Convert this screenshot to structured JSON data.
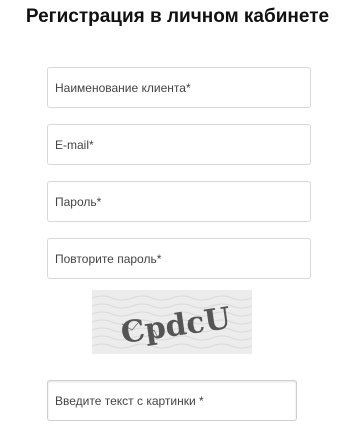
{
  "title": "Регистрация в личном кабинете",
  "fields": {
    "client_name": {
      "placeholder": "Наименование клиента*",
      "value": ""
    },
    "email": {
      "placeholder": "E-mail*",
      "value": ""
    },
    "password": {
      "placeholder": "Пароль*",
      "value": ""
    },
    "password_repeat": {
      "placeholder": "Повторите пароль*",
      "value": ""
    },
    "captcha_text": {
      "placeholder": "Введите текст с картинки *",
      "value": ""
    }
  },
  "captcha": {
    "text": "CpdcU",
    "background_color": "#ececec",
    "text_color": "#555555"
  }
}
